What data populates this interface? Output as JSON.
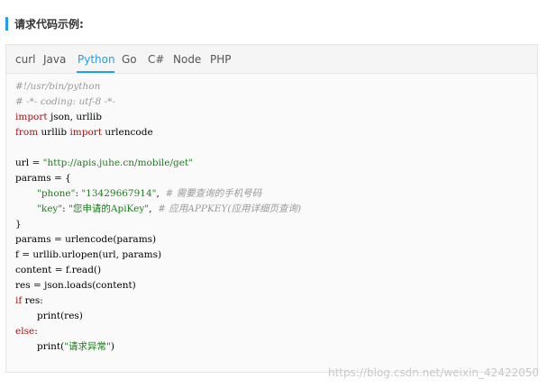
{
  "section": {
    "title": "请求代码示例:"
  },
  "tabs": [
    {
      "label": "curl"
    },
    {
      "label": "Java"
    },
    {
      "label": "Python"
    },
    {
      "label": "Go"
    },
    {
      "label": "C#"
    },
    {
      "label": "Node"
    },
    {
      "label": "PHP"
    }
  ],
  "active_tab": "Python",
  "code": {
    "l01": "#!/usr/bin/python",
    "l02": "# -*- coding: utf-8 -*-",
    "l03_kw": "import",
    "l03_rest": " json, urllib",
    "l04_kw1": "from",
    "l04_mid": " urllib ",
    "l04_kw2": "import",
    "l04_rest": " urlencode",
    "l06_pre": "url = ",
    "l06_str": "\"http://apis.juhe.cn/mobile/get\"",
    "l07": "params = {",
    "l08_str1": "\"phone\"",
    "l08_colon": ": ",
    "l08_str2": "\"13429667914\"",
    "l08_comma": ",  ",
    "l08_comment": "# 需要查询的手机号码",
    "l09_str1": "\"key\"",
    "l09_colon": ": ",
    "l09_str2": "\"您申请的ApiKey\"",
    "l09_comma": ",  ",
    "l09_comment": "# 应用APPKEY(应用详细页查询)",
    "l10": "}",
    "l11": "params = urlencode(params)",
    "l12": "f = urllib.urlopen(url, params)",
    "l13": "content = f.read()",
    "l14": "res = json.loads(content)",
    "l15_kw": "if",
    "l15_rest": " res:",
    "l16": "print(res)",
    "l17_kw": "else",
    "l17_rest": ":",
    "l18_pre": "print(",
    "l18_str": "\"请求异常\"",
    "l18_post": ")"
  },
  "watermark": "https://blog.csdn.net/weixin_42422050",
  "colors": {
    "accent": "#1e9ff2",
    "comment": "#999999",
    "keyword": "#a31515",
    "string": "#1e7a1e"
  }
}
